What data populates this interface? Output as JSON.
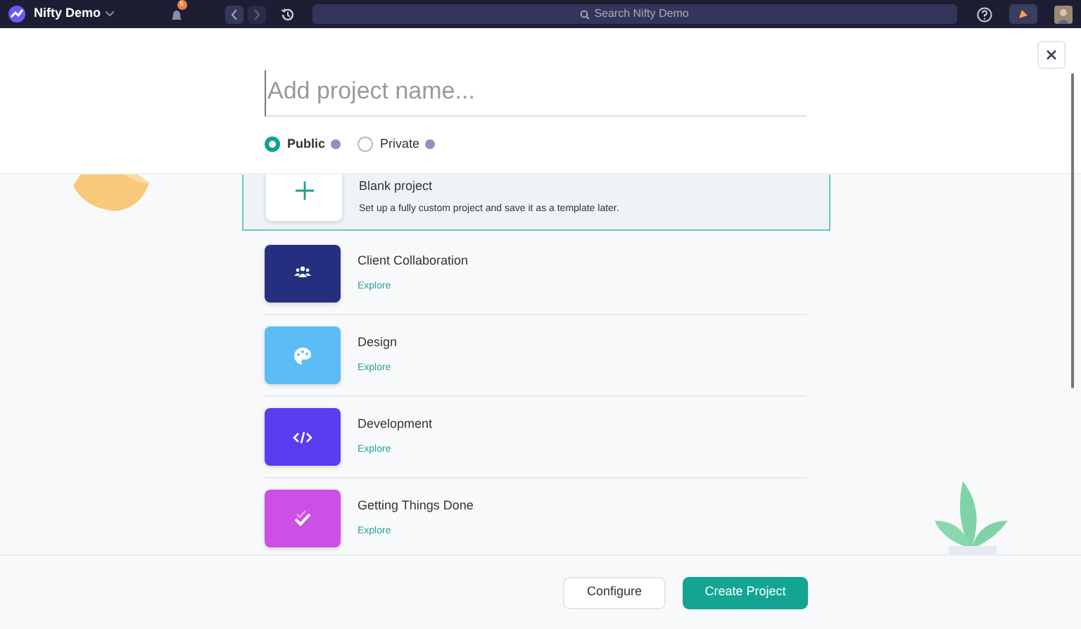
{
  "topbar": {
    "workspace": "Nifty Demo",
    "notification_count": "5",
    "search_placeholder": "Search Nifty Demo"
  },
  "form": {
    "name_placeholder": "Add project name...",
    "visibility": [
      {
        "label": "Public",
        "selected": true
      },
      {
        "label": "Private",
        "selected": false
      }
    ]
  },
  "blank_template": {
    "title": "Blank project",
    "description": "Set up a fully custom project and save it as a template later.",
    "selected": true
  },
  "templates": [
    {
      "title": "Client Collaboration",
      "link": "Explore",
      "kind": "people",
      "color": "#24307f"
    },
    {
      "title": "Design",
      "link": "Explore",
      "kind": "palette",
      "color": "#5bbcf5"
    },
    {
      "title": "Development",
      "link": "Explore",
      "kind": "code",
      "color": "#5b3cf0"
    },
    {
      "title": "Getting Things Done",
      "link": "Explore",
      "kind": "check",
      "color": "#cc4fe6"
    }
  ],
  "buttons": {
    "secondary": "Configure",
    "primary": "Create Project"
  }
}
